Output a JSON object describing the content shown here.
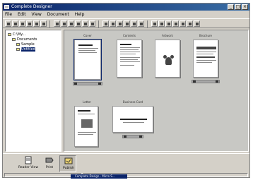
{
  "window": {
    "title": "Complete Designer"
  },
  "menu": [
    "File",
    "Edit",
    "View",
    "Document",
    "Help"
  ],
  "tree": {
    "items": [
      {
        "label": "C:\\My..."
      },
      {
        "label": "Documents"
      },
      {
        "label": "Sample"
      },
      {
        "label": "Untitled"
      }
    ]
  },
  "pages": [
    {
      "label": "Cover"
    },
    {
      "label": "Contents"
    },
    {
      "label": "Artwork"
    },
    {
      "label": "Brochure"
    },
    {
      "label": "Letter"
    },
    {
      "label": "Business Card"
    }
  ],
  "bottom": {
    "buttons": [
      {
        "label": "Reader View"
      },
      {
        "label": "Print"
      },
      {
        "label": "Publish"
      }
    ]
  },
  "status": {
    "left": "",
    "right": "",
    "task_label": "Complete Design - Micro S..."
  },
  "colors": {
    "titlebar": "#0a246a",
    "face": "#d4d0c8",
    "preview_bg": "#c8c8c4"
  }
}
